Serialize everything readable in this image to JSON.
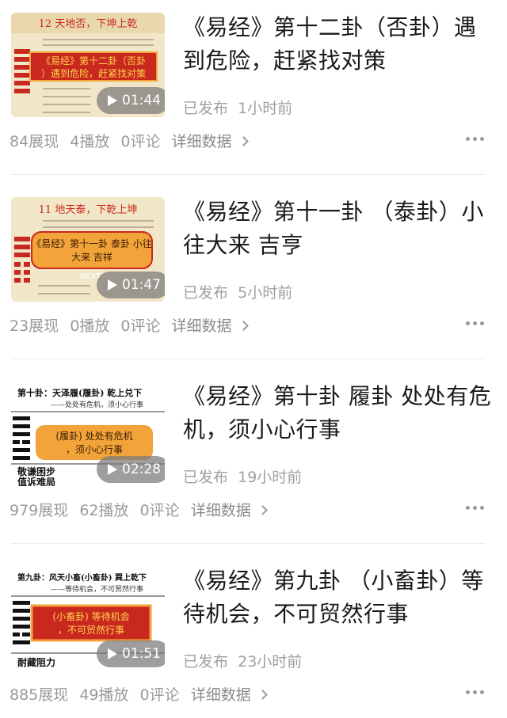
{
  "items": [
    {
      "title": "《易经》第十二卦（否卦）遇到危险，赶紧找对策",
      "duration": "01:44",
      "published": "已发布",
      "time_ago": "1小时前",
      "impressions": "84展现",
      "plays": "4播放",
      "comments": "0评论",
      "detail_link": "详细数据",
      "thumb": {
        "header": "12 天地否，下坤上乾",
        "overlay_1": "《易经》第十二卦（否卦",
        "overlay_2": "）遇到危险，赶紧找对策"
      }
    },
    {
      "title": "《易经》第十一卦 （泰卦）小往大来 吉亨",
      "duration": "01:47",
      "published": "已发布",
      "time_ago": "5小时前",
      "impressions": "23展现",
      "plays": "0播放",
      "comments": "0评论",
      "detail_link": "详细数据",
      "thumb": {
        "header": "11 地天泰，下乾上坤",
        "overlay_1": "《易经》第十一卦 泰卦 小往",
        "overlay_2": "大来 吉祥",
        "badge": "NEXT"
      }
    },
    {
      "title": "《易经》第十卦 履卦 处处有危机，须小心行事",
      "duration": "02:28",
      "published": "已发布",
      "time_ago": "19小时前",
      "impressions": "979展现",
      "plays": "62播放",
      "comments": "0评论",
      "detail_link": "详细数据",
      "thumb": {
        "header": "第十卦：天泽履(履卦) 乾上兑下",
        "sub": "——处处有危机，须小心行事",
        "overlay_1": "(履卦) 处处有危机",
        "overlay_2": "，须小心行事",
        "bottom_1": "敬谦困步",
        "bottom_2": "值诉难局"
      }
    },
    {
      "title": "《易经》第九卦 （小畜卦）等待机会，不可贸然行事",
      "duration": "01:51",
      "published": "已发布",
      "time_ago": "23小时前",
      "impressions": "885展现",
      "plays": "49播放",
      "comments": "0评论",
      "detail_link": "详细数据",
      "thumb": {
        "header": "第九卦：风天小畜(小畜卦) 巽上乾下",
        "sub": "——等待机会，不可贸然行事",
        "overlay_1": "(小畜卦) 等待机会",
        "overlay_2": "，不可贸然行事",
        "bottom_1": "耐藏阻力"
      }
    }
  ],
  "colors": {
    "accent_red": "#c8281e",
    "stats_gray": "#9a9a9a",
    "overlay_orange": "#f2a43a"
  }
}
